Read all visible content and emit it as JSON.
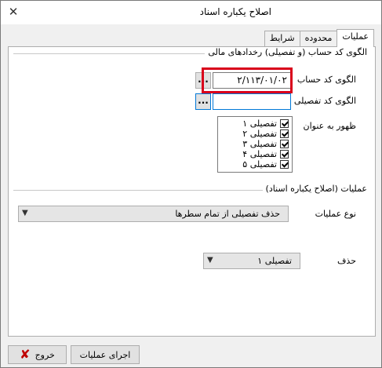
{
  "window": {
    "title": "اصلاح یکباره اسناد",
    "close_icon": "close-icon"
  },
  "tabs": [
    {
      "label": "عملیات",
      "active": true
    },
    {
      "label": "محدوده",
      "active": false
    },
    {
      "label": "شرایط",
      "active": false
    }
  ],
  "group_pattern": {
    "title": "الگوی کد حساب (و تفصیلی) رخدادهای مالی"
  },
  "account_pattern": {
    "label": "الگوی کد حساب",
    "value": "۲/۱۱۳/۰۱/۰۲",
    "button": "..."
  },
  "detail_pattern": {
    "label": "الگوی کد تفصیلی",
    "value": "",
    "button": "..."
  },
  "appear_as": {
    "label": "ظهور به عنوان",
    "items": [
      {
        "label": "تفصیلی ۱",
        "checked": true
      },
      {
        "label": "تفصیلی ۲",
        "checked": true
      },
      {
        "label": "تفصیلی ۳",
        "checked": true
      },
      {
        "label": "تفصیلی ۴",
        "checked": true
      },
      {
        "label": "تفصیلی ۵",
        "checked": true
      }
    ]
  },
  "group_operations": {
    "title": "عملیات (اصلاح یکباره اسناد)"
  },
  "operation_type": {
    "label": "نوع عملیات",
    "value": "حذف تفصیلی از تمام سطرها"
  },
  "delete": {
    "label": "حذف",
    "value": "تفصیلی ۱"
  },
  "buttons": {
    "run": "اجرای عملیات",
    "exit": "خروج"
  },
  "colors": {
    "highlight": "#d9001b",
    "focus": "#0078d7"
  }
}
